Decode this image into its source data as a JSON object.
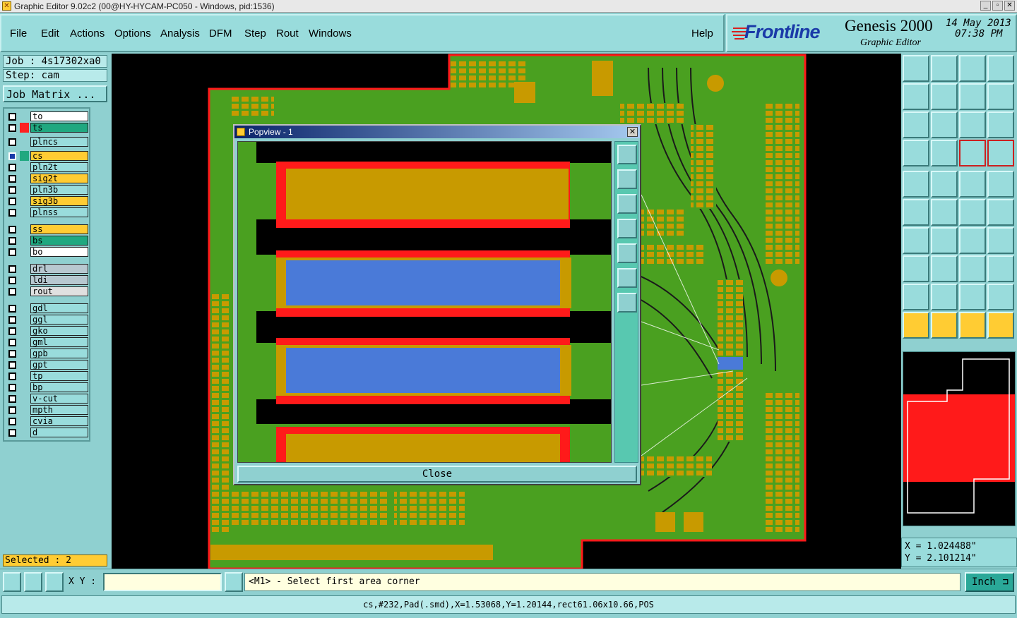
{
  "window": {
    "title": "Graphic Editor 9.02c2 (00@HY-HYCAM-PC050 - Windows, pid:1536)"
  },
  "menu": [
    "File",
    "Edit",
    "Actions",
    "Options",
    "Analysis",
    "DFM",
    "Step",
    "Rout",
    "Windows"
  ],
  "help_label": "Help",
  "brand": {
    "logo": "Frontline",
    "product": "Genesis 2000",
    "subtitle": "Graphic Editor",
    "date": "14 May 2013",
    "time": "07:38 PM"
  },
  "job": {
    "job_label": "Job : 4s17302xa0",
    "step_label": "Step: cam",
    "matrix_button": "Job Matrix ..."
  },
  "layers": [
    {
      "name": "to",
      "color": "#ffffff"
    },
    {
      "name": "ts",
      "color": "#20a880",
      "swatch": "#ff2020"
    },
    {
      "name": "plncs",
      "color": "#99dcdc"
    },
    {
      "name": "cs",
      "color": "#ffcc33",
      "active": true
    },
    {
      "name": "pln2t",
      "color": "#99dcdc"
    },
    {
      "name": "sig2t",
      "color": "#ffcc33"
    },
    {
      "name": "pln3b",
      "color": "#99dcdc"
    },
    {
      "name": "sig3b",
      "color": "#ffcc33"
    },
    {
      "name": "plnss",
      "color": "#99dcdc"
    },
    {
      "name": "ss",
      "color": "#ffcc33"
    },
    {
      "name": "bs",
      "color": "#20a880"
    },
    {
      "name": "bo",
      "color": "#ffffff"
    },
    {
      "name": "drl",
      "color": "#b8c8d0"
    },
    {
      "name": "ldi",
      "color": "#b8c8d0"
    },
    {
      "name": "rout",
      "color": "#e0e0e0"
    },
    {
      "name": "gdl",
      "color": "#99dcdc"
    },
    {
      "name": "ggl",
      "color": "#99dcdc"
    },
    {
      "name": "gko",
      "color": "#99dcdc"
    },
    {
      "name": "gml",
      "color": "#99dcdc"
    },
    {
      "name": "gpb",
      "color": "#99dcdc"
    },
    {
      "name": "gpt",
      "color": "#99dcdc"
    },
    {
      "name": "tp",
      "color": "#99dcdc"
    },
    {
      "name": "bp",
      "color": "#99dcdc"
    },
    {
      "name": "v-cut",
      "color": "#99dcdc"
    },
    {
      "name": "mpth",
      "color": "#99dcdc"
    },
    {
      "name": "cvia",
      "color": "#99dcdc"
    },
    {
      "name": "d",
      "color": "#99dcdc"
    }
  ],
  "selected_label": "Selected : 2",
  "popview": {
    "title": "Popview - 1",
    "close_label": "Close"
  },
  "coords": {
    "x": "X = 1.024488\"",
    "y": "Y = 2.101214\""
  },
  "cmd": {
    "xy_label": "X Y :",
    "xy_value": "",
    "prompt": "<M1> - Select first area corner",
    "unit": "Inch"
  },
  "status": "cs,#232,Pad(.smd),X=1.53068,Y=1.20144,rect61.06x10.66,POS",
  "colors": {
    "board": "#4aa020",
    "copper": "#c89a00",
    "mask": "#ff1a1a",
    "selected": "#4a7ad8"
  }
}
